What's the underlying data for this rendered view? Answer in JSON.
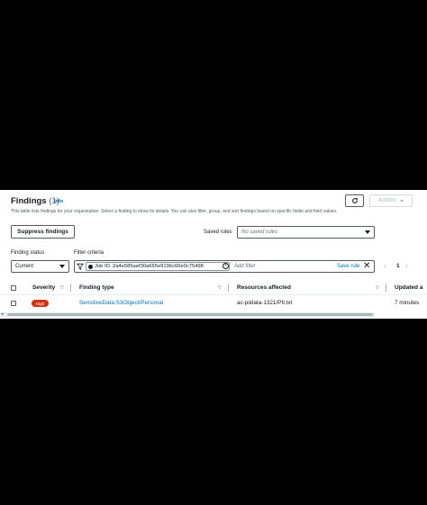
{
  "header": {
    "title": "Findings",
    "count": "(1)",
    "info": "Info",
    "description": "This table lists findings for your organization. Select a finding to show its details. You can also filter, group, and sort findings based on specific fields and field values.",
    "actions_label": "Actions"
  },
  "toolbar": {
    "suppress_label": "Suppress findings",
    "saved_rules_label": "Saved rules",
    "saved_rules_placeholder": "No saved rules"
  },
  "filters": {
    "status_label": "Finding status",
    "status_value": "Current",
    "criteria_label": "Filter criteria",
    "token": "Job ID: 2a4e585aef30a665e9196c60e0c75498",
    "add_filter_placeholder": "Add filter",
    "save_rule": "Save rule"
  },
  "pagination": {
    "page": "1"
  },
  "table": {
    "columns": [
      "Severity",
      "Finding type",
      "Resources affected",
      "Updated a"
    ],
    "rows": [
      {
        "severity": "High",
        "finding_type": "SensitiveData:S3Object/Personal",
        "resource": "ac-piidata-1321/PII.txt",
        "updated": "7 minutes"
      }
    ]
  },
  "colors": {
    "accent": "#0073bb",
    "severity_high": "#d13212"
  }
}
